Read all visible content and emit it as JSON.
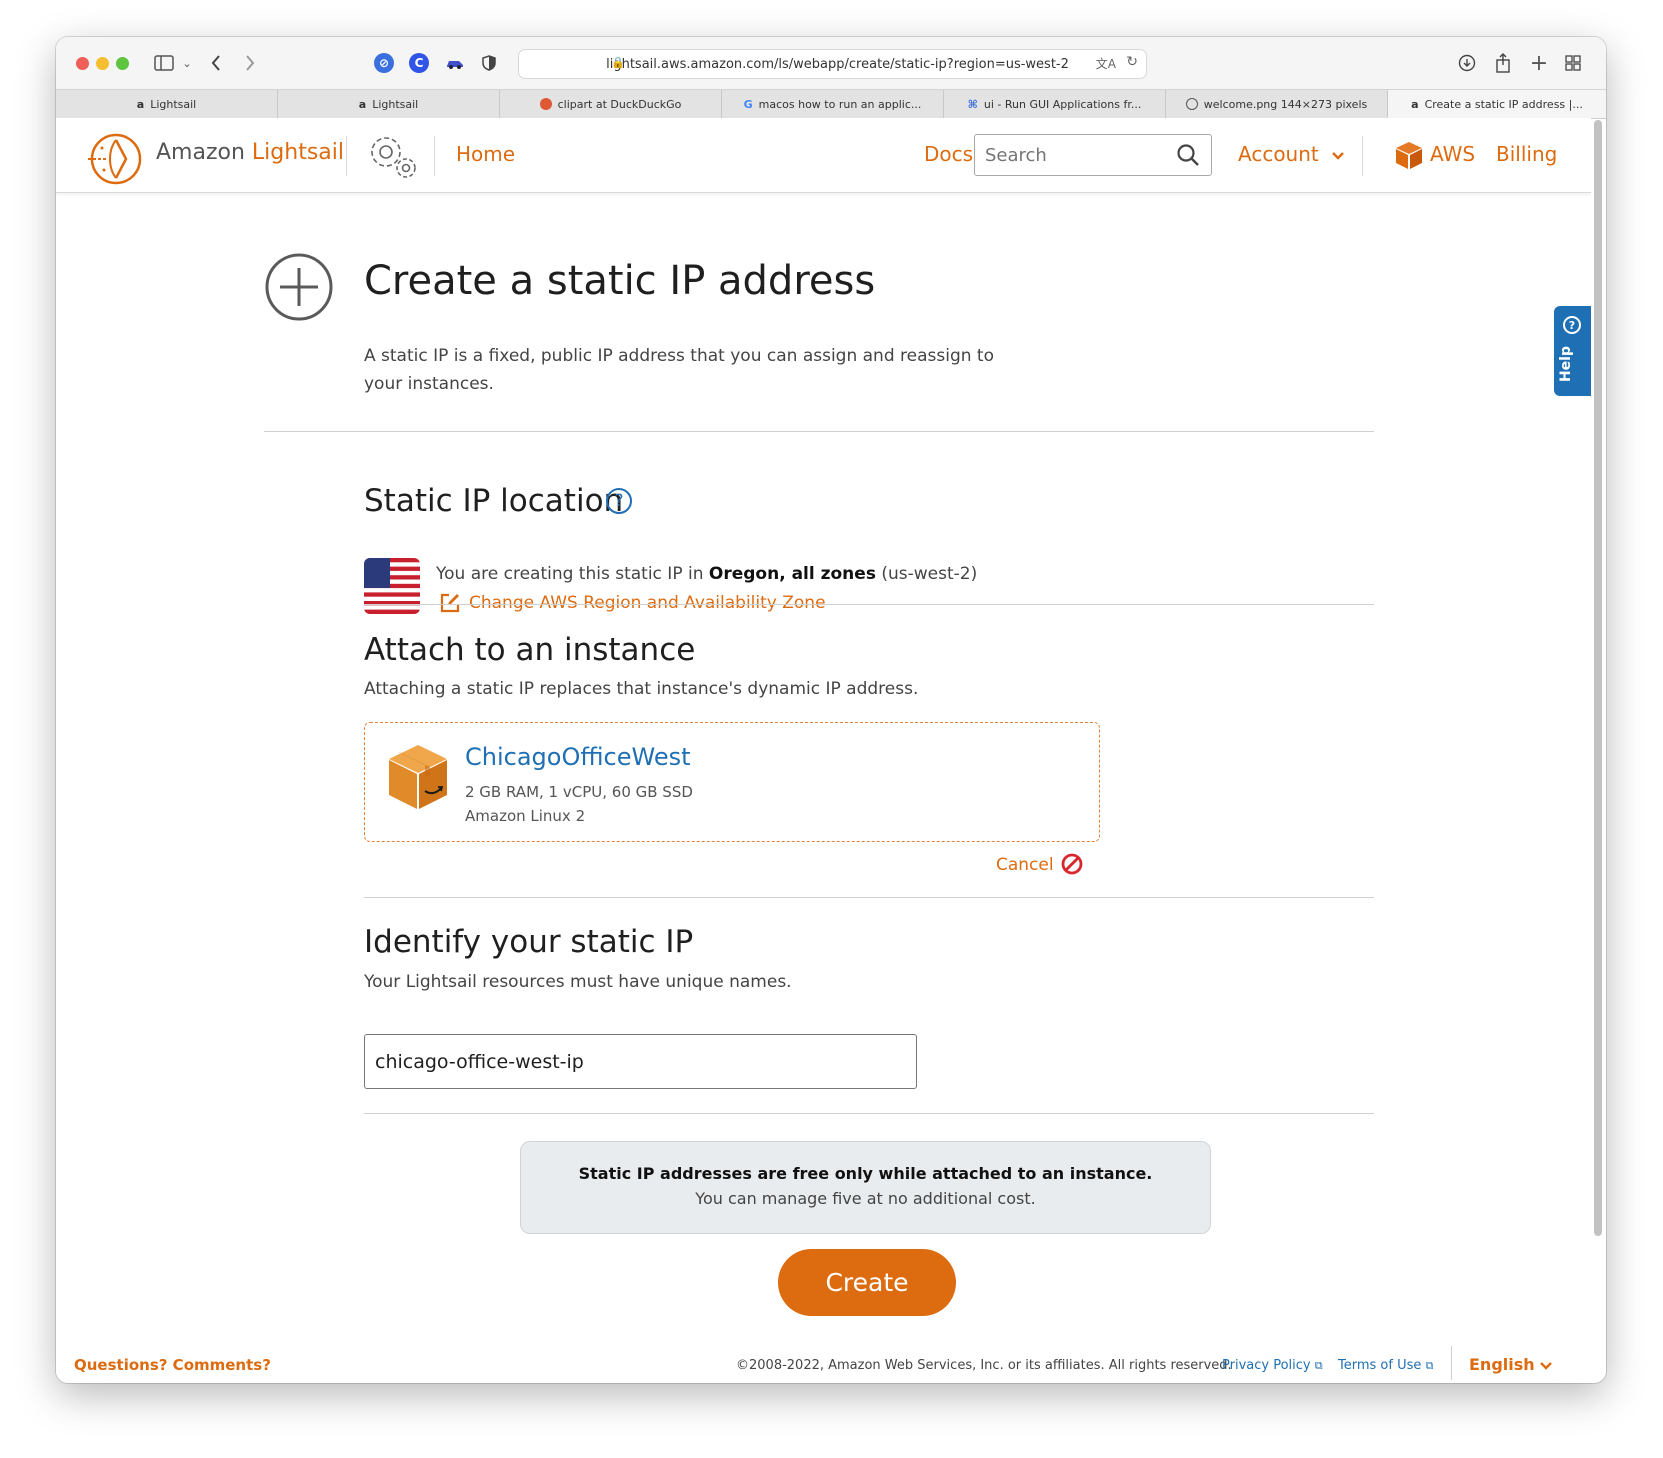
{
  "browser": {
    "url": "lightsail.aws.amazon.com/ls/webapp/create/static-ip?region=us-west-2",
    "tabs": [
      {
        "favicon": "a",
        "title": "Lightsail"
      },
      {
        "favicon": "a",
        "title": "Lightsail"
      },
      {
        "favicon": "duckduckgo-icon",
        "title": "clipart at DuckDuckGo"
      },
      {
        "favicon": "G",
        "title": "macos how to run an applic..."
      },
      {
        "favicon": "⌘",
        "title": "ui - Run GUI Applications fr..."
      },
      {
        "favicon": "compass-icon",
        "title": "welcome.png 144×273 pixels"
      },
      {
        "favicon": "a",
        "title": "Create a static IP address |..."
      }
    ]
  },
  "header": {
    "brand_prefix": "Amazon",
    "brand_name": "Lightsail",
    "home": "Home",
    "docs": "Docs",
    "search_placeholder": "Search",
    "account": "Account",
    "aws": "AWS",
    "billing": "Billing"
  },
  "help": {
    "label": "Help"
  },
  "page": {
    "title": "Create a static IP address",
    "intro": "A static IP is a fixed, public IP address that you can assign and reassign to your instances."
  },
  "location": {
    "heading": "Static IP location",
    "prefix": "You are creating this static IP in ",
    "region_name": "Oregon, all zones",
    "region_code": " (us-west-2)",
    "change_link": "Change AWS Region and Availability Zone"
  },
  "attach": {
    "heading": "Attach to an instance",
    "description": "Attaching a static IP replaces that instance's dynamic IP address.",
    "instance": {
      "name": "ChicagoOfficeWest",
      "spec": "2 GB RAM, 1 vCPU, 60 GB SSD",
      "os": "Amazon Linux 2"
    },
    "cancel": "Cancel"
  },
  "identify": {
    "heading": "Identify your static IP",
    "description": "Your Lightsail resources must have unique names.",
    "value": "chicago-office-west-ip"
  },
  "notice": {
    "bold": "Static IP addresses are free only while attached to an instance.",
    "text": "You can manage five at no additional cost."
  },
  "create_button": "Create",
  "footer": {
    "questions": "Questions? Comments?",
    "copyright": "©2008-2022, Amazon Web Services, Inc. or its affiliates. All rights reserved.",
    "privacy": "Privacy Policy",
    "terms": "Terms of Use",
    "language": "English"
  },
  "colors": {
    "accent": "#dd6b10",
    "link": "#1f6fb5"
  }
}
